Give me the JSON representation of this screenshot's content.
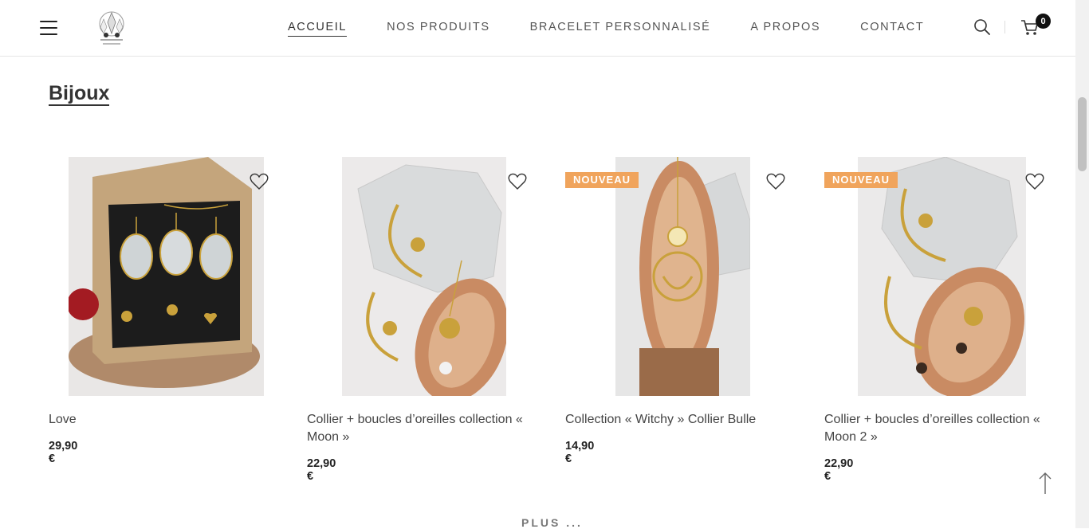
{
  "header": {
    "logo_alt": "Mahalo's Secret",
    "nav": [
      {
        "label": "ACCUEIL",
        "active": true
      },
      {
        "label": "NOS PRODUITS",
        "active": false
      },
      {
        "label": "BRACELET PERSONNALISÉ",
        "active": false
      },
      {
        "label": "A PROPOS",
        "active": false
      },
      {
        "label": "CONTACT",
        "active": false
      }
    ],
    "cart_count": "0"
  },
  "section": {
    "title": "Bijoux"
  },
  "products": [
    {
      "name": "Love",
      "price": "29,90 €",
      "badge": ""
    },
    {
      "name": "Collier + boucles d’oreilles collection « Moon »",
      "price": "22,90 €",
      "badge": ""
    },
    {
      "name": "Collection « Witchy » Collier Bulle",
      "price": "14,90 €",
      "badge": "NOUVEAU"
    },
    {
      "name": "Collier + boucles d’oreilles collection « Moon 2 »",
      "price": "22,90 €",
      "badge": "NOUVEAU"
    }
  ],
  "more_label": "PLUS ...",
  "colors": {
    "badge": "#f0a45c",
    "text": "#222222",
    "nav": "#555555"
  }
}
